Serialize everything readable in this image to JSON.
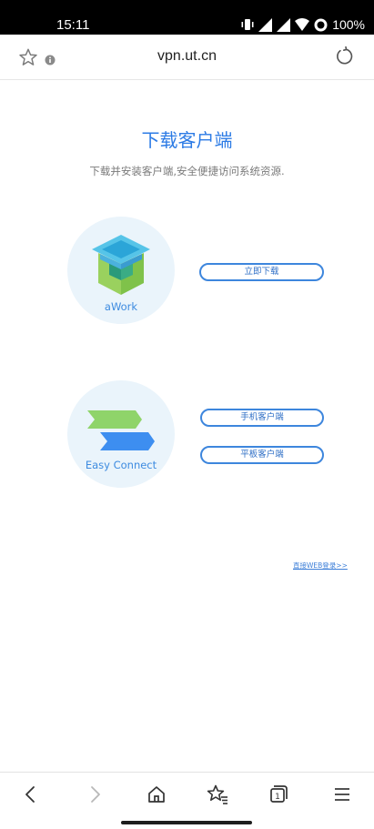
{
  "status_bar": {
    "time": "15:11",
    "battery": "100%"
  },
  "browser": {
    "url": "vpn.ut.cn"
  },
  "page": {
    "title": "下载客户端",
    "subtitle": "下载并安装客户端,安全便捷访问系统资源.",
    "clients": [
      {
        "name": "aWork",
        "buttons": [
          "立即下载"
        ]
      },
      {
        "name": "Easy Connect",
        "buttons": [
          "手机客户端",
          "平板客户端"
        ]
      }
    ],
    "web_login": "直接WEB登录>>"
  },
  "colors": {
    "accent": "#2c7be5",
    "circle_bg": "#eaf4fb",
    "button_border": "#3d86dd"
  },
  "icons": [
    "star-icon",
    "info-icon",
    "reload-icon",
    "back-icon",
    "forward-icon",
    "home-icon",
    "bookmarks-icon",
    "tabs-icon",
    "menu-icon"
  ]
}
